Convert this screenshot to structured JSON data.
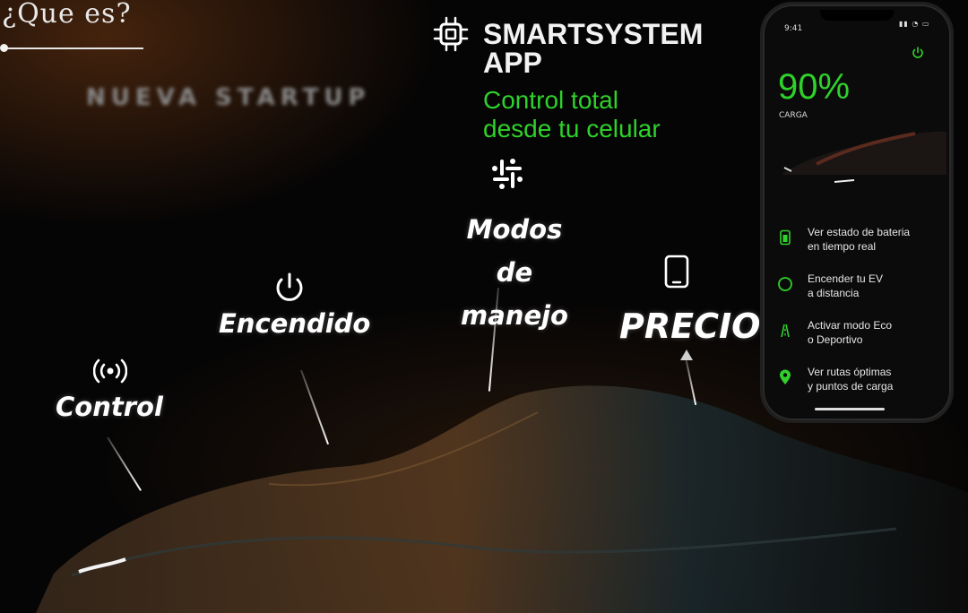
{
  "header": {
    "question": "¿Que  es?",
    "startup_label": "NUEVA STARTUP"
  },
  "app": {
    "title_line1": "SMARTSYSTEM",
    "title_line2": "APP",
    "subtitle_line1": "Control total",
    "subtitle_line2": "desde tu celular"
  },
  "features": {
    "control": "Control",
    "encendido": "Encendido",
    "modos_line1": "Modos de",
    "modos_line2": "manejo",
    "precio": "PRECIO"
  },
  "phone": {
    "time": "9:41",
    "battery_pct": "90%",
    "battery_label": "CARGA",
    "items": [
      {
        "line1": "Ver estado de bateria",
        "line2": "en tiempo real"
      },
      {
        "line1": "Encender tu EV",
        "line2": "a distancia"
      },
      {
        "line1": "Activar modo Eco",
        "line2": "o Deportivo"
      },
      {
        "line1": "Ver rutas óptimas",
        "line2": "y puntos de carga"
      }
    ]
  },
  "colors": {
    "accent_green": "#2fd12b",
    "text_white": "#ffffff"
  },
  "icons": [
    "chip-icon",
    "slack-icon",
    "power-icon",
    "tablet-icon",
    "antenna-icon",
    "battery-icon",
    "circle-icon",
    "road-icon",
    "location-pin-icon"
  ]
}
